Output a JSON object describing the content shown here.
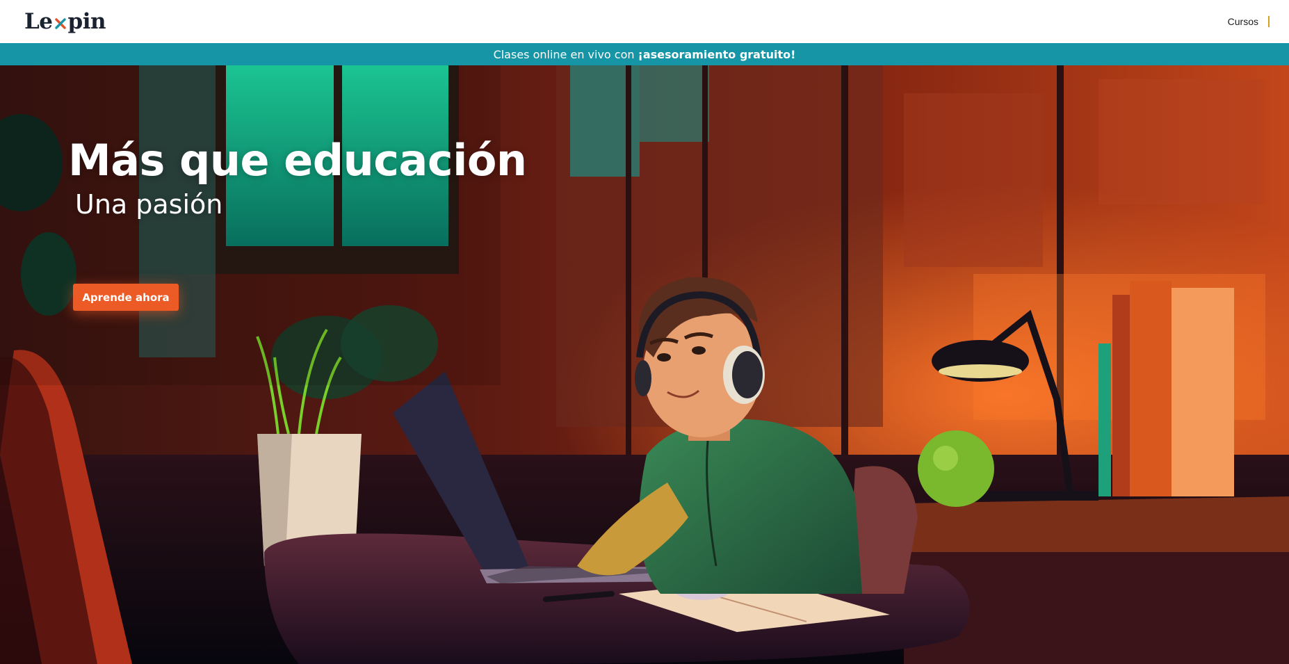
{
  "header": {
    "logo_text_left": "Le",
    "logo_text_right": "pin",
    "logo_mark": "x-mark-icon",
    "nav": [
      {
        "label": "Cursos"
      }
    ]
  },
  "promo": {
    "text": "Clases online en vivo con",
    "highlight": "¡asesoramiento gratuito!"
  },
  "hero": {
    "title": "Más que educación",
    "subtitle": "Una pasión",
    "cta_label": "Aprende ahora",
    "image_description_icon": "student-at-laptop-illustration"
  },
  "colors": {
    "header_bg": "#ffffff",
    "promo_bg": "#1595a6",
    "cta": "#ec5a26",
    "nav_divider": "#d4a11e",
    "logo_text": "#1a2230"
  }
}
